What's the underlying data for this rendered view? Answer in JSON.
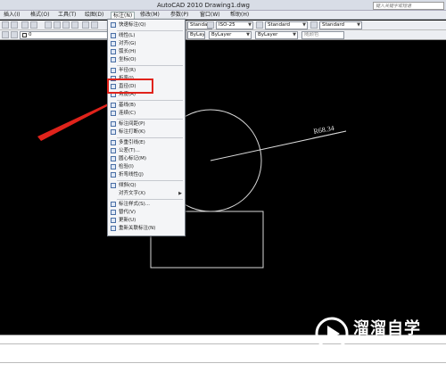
{
  "window": {
    "title": "AutoCAD 2010    Drawing1.dwg",
    "help_placeholder": "键入关键字或短语"
  },
  "menubar": {
    "items": [
      {
        "label": "插入(I)"
      },
      {
        "label": "格式(O)"
      },
      {
        "label": "工具(T)"
      },
      {
        "label": "绘图(D)"
      },
      {
        "label": "标注(N)"
      },
      {
        "label": "修改(M)"
      },
      {
        "label": "参数(P)"
      },
      {
        "label": "窗口(W)"
      },
      {
        "label": "帮助(H)"
      }
    ],
    "active": "标注(N)"
  },
  "toolbar": {
    "text_style": "Standard",
    "dim_style": "ISO-25",
    "table_style": "Standard",
    "mleader_style": "Standard",
    "layer": "0",
    "color": "ByLayer",
    "linetype": "ByLayer",
    "lineweight": "ByLayer",
    "plot_style": "随颜色"
  },
  "dimension_menu": {
    "items": [
      {
        "label": "快速标注(Q)",
        "icon": "quick-dim-icon"
      },
      {
        "label": "线性(L)",
        "icon": "linear-icon"
      },
      {
        "label": "对齐(G)",
        "icon": "aligned-icon"
      },
      {
        "label": "弧长(H)",
        "icon": "arc-length-icon"
      },
      {
        "label": "坐标(O)",
        "icon": "ordinate-icon"
      },
      {
        "label": "半径(R)",
        "icon": "radius-icon"
      },
      {
        "label": "折弯(J)",
        "icon": "jogged-icon"
      },
      {
        "label": "直径(D)",
        "icon": "diameter-icon"
      },
      {
        "label": "角度(A)",
        "icon": "angle-icon"
      },
      {
        "label": "基线(B)",
        "icon": "baseline-icon"
      },
      {
        "label": "连续(C)",
        "icon": "continue-icon"
      },
      {
        "label": "标注间距(P)",
        "icon": "dim-space-icon"
      },
      {
        "label": "标注打断(K)",
        "icon": "dim-break-icon"
      },
      {
        "label": "多重引线(E)",
        "icon": "multileader-icon"
      },
      {
        "label": "公差(T)...",
        "icon": "tolerance-icon"
      },
      {
        "label": "圆心标记(M)",
        "icon": "center-mark-icon"
      },
      {
        "label": "检验(I)",
        "icon": "inspect-icon"
      },
      {
        "label": "折弯线性(J)",
        "icon": "jogged-linear-icon"
      },
      {
        "label": "倾斜(Q)",
        "icon": "oblique-icon"
      },
      {
        "label": "对齐文字(X)",
        "icon": ""
      },
      {
        "label": "标注样式(S)...",
        "icon": "dim-style-icon"
      },
      {
        "label": "替代(V)",
        "icon": "override-icon"
      },
      {
        "label": "更新(U)",
        "icon": "update-icon"
      },
      {
        "label": "重新关联标注(N)",
        "icon": "reassociate-icon"
      }
    ],
    "highlighted": "直径(D)"
  },
  "drawing": {
    "dimension_text": "R68.34",
    "annotation_color": "#e0231b"
  },
  "watermark": {
    "brand": "溜溜自学",
    "url": "ZIXUE.3D66.COM"
  }
}
